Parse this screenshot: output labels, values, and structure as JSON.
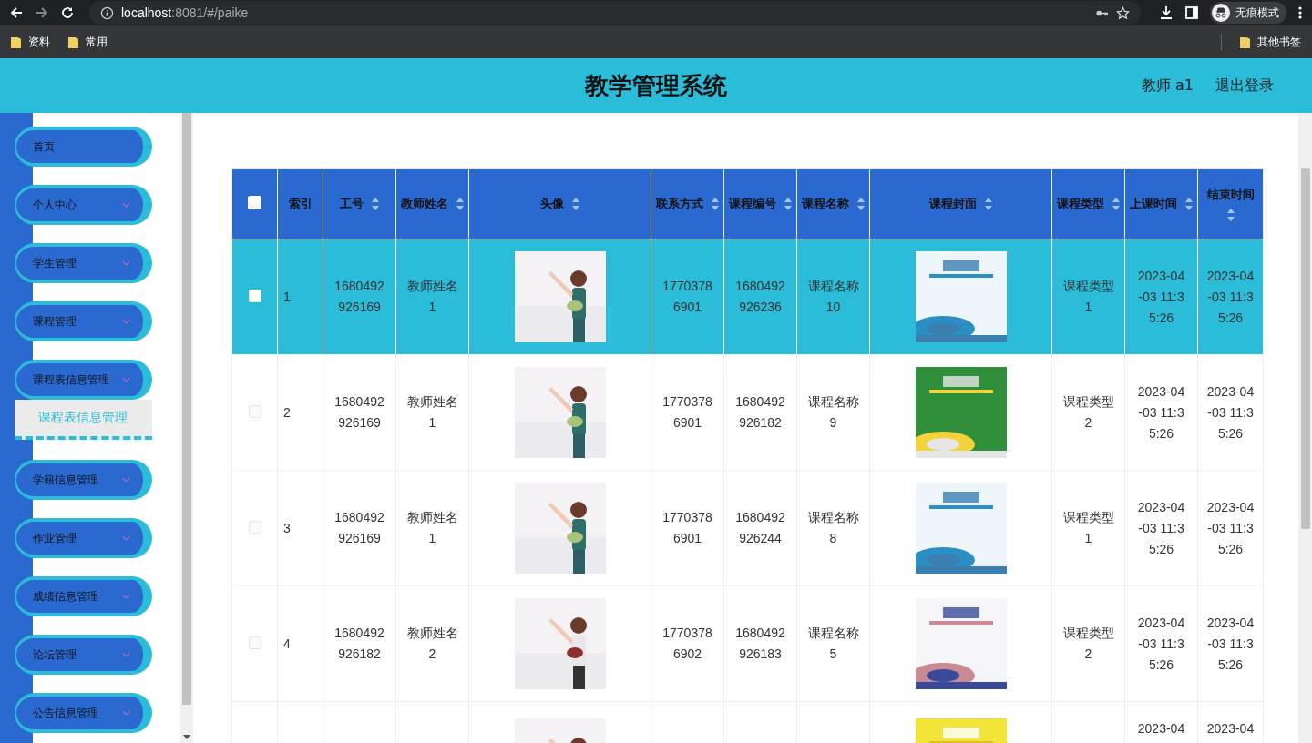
{
  "browser": {
    "url_host": "localhost",
    "url_path": ":8081/#/paike",
    "bookmarks": [
      "资料",
      "常用"
    ],
    "other_bookmarks": "其他书签",
    "profile": "无痕模式"
  },
  "header": {
    "title": "教学管理系统",
    "user": "教师 a1",
    "logout": "退出登录"
  },
  "sidebar": {
    "items": [
      {
        "label": "首页",
        "kind": "link",
        "expanded": false
      },
      {
        "label": "个人中心",
        "kind": "menu",
        "expanded": false
      },
      {
        "label": "学生管理",
        "kind": "menu",
        "expanded": false
      },
      {
        "label": "课程管理",
        "kind": "menu",
        "expanded": false
      },
      {
        "label": "课程表信息管理",
        "kind": "menu",
        "expanded": true,
        "children": [
          {
            "label": "课程表信息管理",
            "selected": true
          }
        ]
      },
      {
        "label": "学籍信息管理",
        "kind": "menu",
        "expanded": false
      },
      {
        "label": "作业管理",
        "kind": "menu",
        "expanded": false
      },
      {
        "label": "成绩信息管理",
        "kind": "menu",
        "expanded": false
      },
      {
        "label": "论坛管理",
        "kind": "menu",
        "expanded": false
      },
      {
        "label": "公告信息管理",
        "kind": "menu",
        "expanded": false
      }
    ]
  },
  "table": {
    "select_all_checked": false,
    "columns": [
      {
        "kind": "checkbox"
      },
      {
        "kind": "text",
        "label": "索引",
        "sortable": false
      },
      {
        "kind": "text",
        "label": "工号",
        "sortable": true
      },
      {
        "kind": "text",
        "label": "教师姓名",
        "sortable": true
      },
      {
        "kind": "avatar",
        "label": "头像",
        "sortable": true
      },
      {
        "kind": "text",
        "label": "联系方式",
        "sortable": true
      },
      {
        "kind": "text",
        "label": "课程编号",
        "sortable": true
      },
      {
        "kind": "text",
        "label": "课程名称",
        "sortable": true
      },
      {
        "kind": "cover",
        "label": "课程封面",
        "sortable": true
      },
      {
        "kind": "text",
        "label": "课程类型",
        "sortable": true
      },
      {
        "kind": "text",
        "label": "上课时间",
        "sortable": true
      },
      {
        "kind": "text",
        "label": "结束时间",
        "sortable": true
      }
    ],
    "rows": [
      {
        "kind": "full",
        "selected": true,
        "cells": [
          "",
          "1",
          "1680492926169",
          "教师姓名1",
          "",
          "17703786901",
          "1680492926236",
          "课程名称10",
          "",
          "课程类型1",
          "2023-04-03 11:35:26",
          "2023-04-03 11:35:26"
        ]
      },
      {
        "kind": "full",
        "selected": false,
        "cells": [
          "",
          "2",
          "1680492926169",
          "教师姓名1",
          "",
          "17703786901",
          "1680492926182",
          "课程名称9",
          "",
          "课程类型2",
          "2023-04-03 11:35:26",
          "2023-04-03 11:35:26"
        ]
      },
      {
        "kind": "full",
        "selected": false,
        "cells": [
          "",
          "3",
          "1680492926169",
          "教师姓名1",
          "",
          "17703786901",
          "1680492926244",
          "课程名称8",
          "",
          "课程类型1",
          "2023-04-03 11:35:26",
          "2023-04-03 11:35:26"
        ]
      },
      {
        "kind": "full",
        "selected": false,
        "cells": [
          "",
          "4",
          "1680492926182",
          "教师姓名2",
          "",
          "17703786902",
          "1680492926183",
          "课程名称5",
          "",
          "课程类型2",
          "2023-04-03 11:35:26",
          "2023-04-03 11:35:26"
        ]
      },
      {
        "kind": "cut",
        "selected": false,
        "cells": [
          "",
          "",
          "",
          "",
          "",
          "",
          "",
          "",
          "",
          "",
          "2023-04",
          "2023-04"
        ]
      }
    ]
  }
}
